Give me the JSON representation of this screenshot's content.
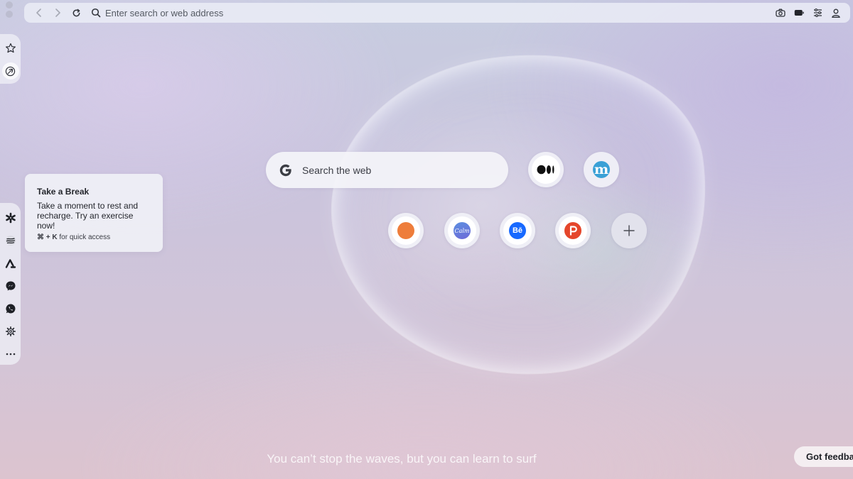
{
  "address_bar": {
    "placeholder": "Enter search or web address"
  },
  "tooltip": {
    "title": "Take a Break",
    "body": "Take a moment to rest and recharge. Try an exercise now!",
    "shortcut_keys": "⌘ + K",
    "shortcut_hint": " for quick access"
  },
  "search": {
    "placeholder": "Search the web"
  },
  "speed_dial": [
    {
      "name": "Medium",
      "icon": "medium-icon"
    },
    {
      "name": "Mail",
      "icon": "m-logo-icon"
    },
    {
      "name": "Orange site",
      "icon": "orange-circle-icon"
    },
    {
      "name": "Calm",
      "icon": "calm-icon"
    },
    {
      "name": "Behance",
      "icon": "behance-icon"
    },
    {
      "name": "Product Hunt",
      "icon": "product-hunt-icon"
    }
  ],
  "quote": "You can’t stop the waves, but you can learn to surf",
  "feedback_label": "Got feedback?",
  "colors": {
    "accent_orange": "#ee7d3b",
    "behance_blue": "#1769ff",
    "product_hunt_red": "#e5462b",
    "m_blue": "#3aa0d6"
  }
}
